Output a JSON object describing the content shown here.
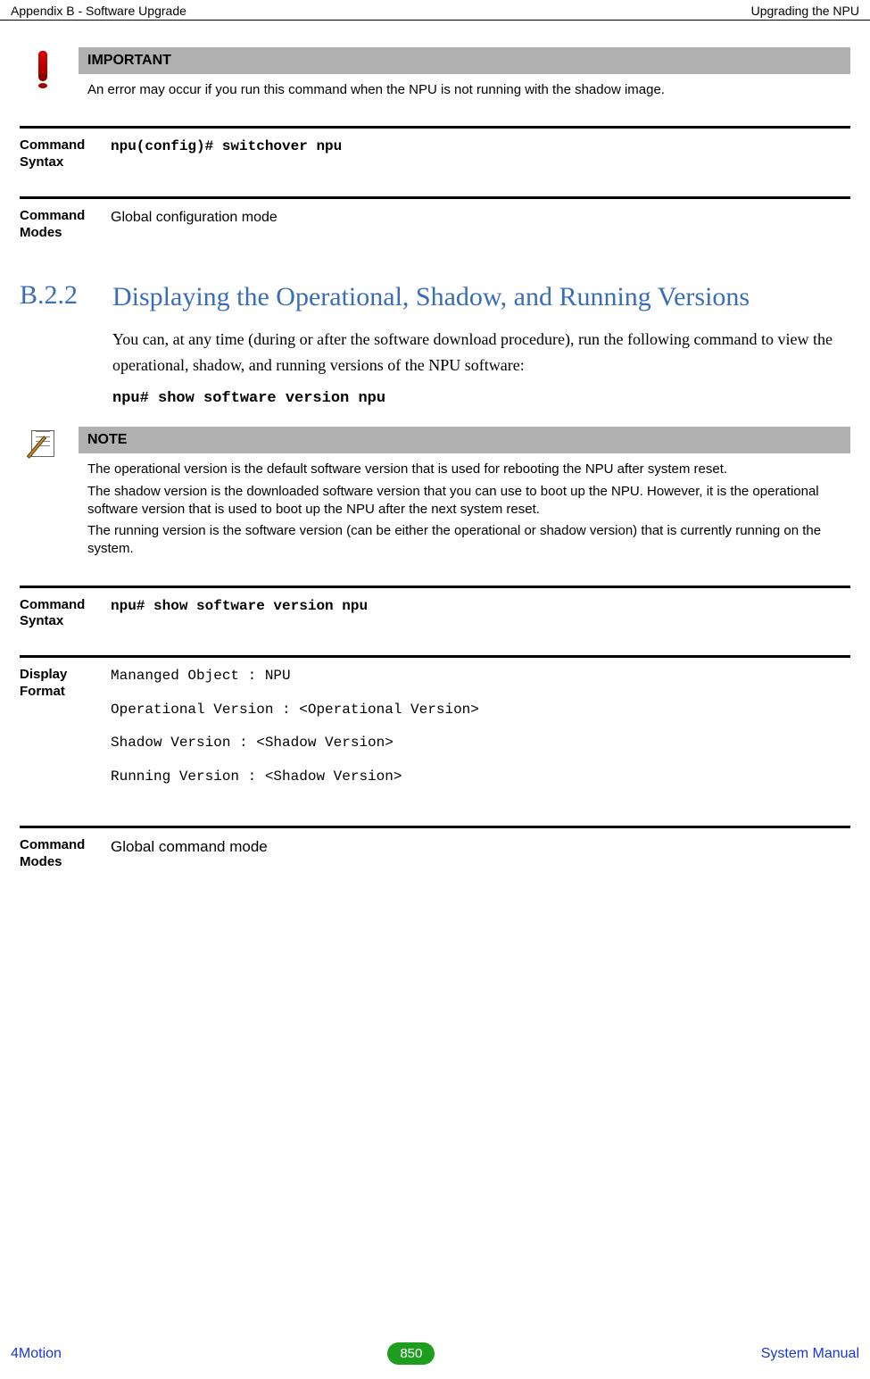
{
  "header": {
    "left": "Appendix B - Software Upgrade",
    "right": "Upgrading the NPU"
  },
  "important": {
    "title": "IMPORTANT",
    "body": "An error may occur if you run this command when the NPU is not running with the shadow image."
  },
  "cmd1": {
    "label": "Command Syntax",
    "value": "npu(config)# switchover npu"
  },
  "cmd2": {
    "label": "Command Modes",
    "value": "Global configuration mode"
  },
  "section": {
    "num": "B.2.2",
    "title": "Displaying the Operational, Shadow, and Running Versions"
  },
  "para1": "You can, at any time (during or after the software download procedure), run the following command to view the operational, shadow, and running versions of the NPU software:",
  "cmdline": "npu# show software version npu",
  "note": {
    "title": "NOTE",
    "p1": "The operational version is the default software version that is used for rebooting the NPU after system reset.",
    "p2": "The shadow version is the downloaded software version that you can use to boot up the NPU. However, it is the operational software version that is used to boot up the NPU after the next system reset.",
    "p3": "The running version is the software version (can be either the operational or shadow version) that is currently running on the system."
  },
  "cmd3": {
    "label": "Command Syntax",
    "value": "npu# show software version npu"
  },
  "cmd4": {
    "label": "Display Format",
    "l1": "Mananged Object  : NPU",
    "l2": "Operational Version : <Operational Version>",
    "l3": "Shadow Version      : <Shadow Version>",
    "l4": "Running Version     : <Shadow Version>"
  },
  "cmd5": {
    "label": "Command Modes",
    "value": "Global command mode"
  },
  "footer": {
    "left": "4Motion",
    "page": "850",
    "right": "System Manual"
  }
}
